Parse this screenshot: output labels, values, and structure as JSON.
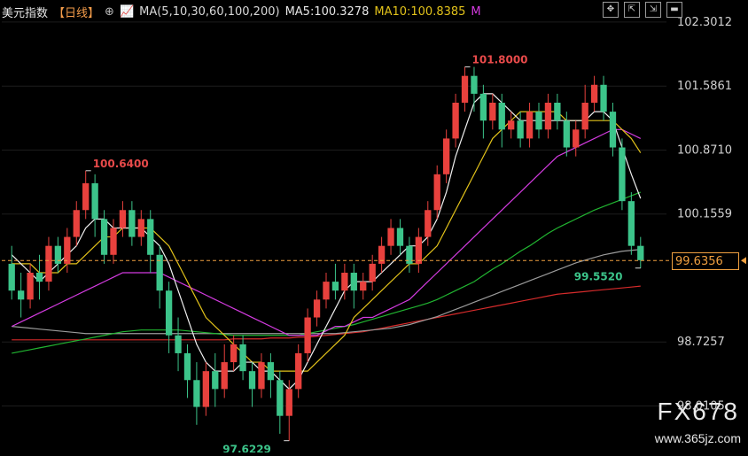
{
  "header": {
    "title": "美元指数",
    "period": "【日线】",
    "ma_label": "MA(5,10,30,60,100,200)",
    "ma5": "MA5:100.3278",
    "ma10": "MA10:100.8385",
    "ma_more": "M"
  },
  "watermark": {
    "brand": "FX678",
    "site": "www.365jz.com"
  },
  "current_price": "99.6356",
  "colors": {
    "up": "#e8413d",
    "down": "#3cc48a",
    "ma5": "#f0f0f0",
    "ma10": "#e2c21a",
    "ma30": "#d43be0",
    "ma60": "#21b531",
    "ma100": "#9b9b9b",
    "ma200": "#d62b2b",
    "price_line": "#f0a040"
  },
  "chart_data": {
    "type": "candlestick",
    "title": "美元指数",
    "ylim": [
      97.6,
      102.35
    ],
    "y_ticks": [
      "102.3012",
      "101.5861",
      "100.8710",
      "100.1559",
      "99.6356",
      "98.7257",
      "98.0105"
    ],
    "annotations": [
      {
        "text": "100.6400",
        "value": 100.64,
        "type": "high"
      },
      {
        "text": "101.8000",
        "value": 101.8,
        "type": "high"
      },
      {
        "text": "97.6229",
        "value": 97.6229,
        "type": "low"
      },
      {
        "text": "99.5520",
        "value": 99.552,
        "type": "low"
      }
    ],
    "current_price": 99.6356,
    "candles": [
      [
        99.6,
        99.3,
        99.8,
        99.2
      ],
      [
        99.3,
        99.2,
        99.5,
        99.0
      ],
      [
        99.2,
        99.5,
        99.6,
        99.1
      ],
      [
        99.5,
        99.4,
        99.7,
        99.2
      ],
      [
        99.4,
        99.8,
        99.9,
        99.3
      ],
      [
        99.8,
        99.6,
        99.9,
        99.5
      ],
      [
        99.6,
        99.9,
        100.0,
        99.5
      ],
      [
        99.9,
        100.2,
        100.3,
        99.8
      ],
      [
        100.2,
        100.5,
        100.64,
        100.1
      ],
      [
        100.5,
        100.1,
        100.6,
        99.9
      ],
      [
        100.1,
        99.7,
        100.2,
        99.6
      ],
      [
        99.7,
        100.0,
        100.1,
        99.6
      ],
      [
        100.0,
        100.2,
        100.3,
        99.9
      ],
      [
        100.2,
        99.9,
        100.3,
        99.8
      ],
      [
        99.9,
        100.1,
        100.2,
        99.8
      ],
      [
        100.1,
        99.7,
        100.2,
        99.5
      ],
      [
        99.7,
        99.3,
        99.8,
        99.1
      ],
      [
        99.3,
        98.8,
        99.4,
        98.6
      ],
      [
        98.8,
        98.6,
        99.0,
        98.4
      ],
      [
        98.6,
        98.3,
        98.7,
        98.1
      ],
      [
        98.3,
        98.0,
        98.5,
        97.8
      ],
      [
        98.0,
        98.4,
        98.5,
        97.9
      ],
      [
        98.4,
        98.2,
        98.6,
        98.0
      ],
      [
        98.2,
        98.5,
        98.7,
        98.1
      ],
      [
        98.5,
        98.7,
        98.8,
        98.4
      ],
      [
        98.7,
        98.4,
        98.8,
        98.3
      ],
      [
        98.4,
        98.2,
        98.5,
        98.0
      ],
      [
        98.2,
        98.5,
        98.6,
        98.1
      ],
      [
        98.5,
        98.3,
        98.6,
        98.1
      ],
      [
        98.3,
        97.9,
        98.4,
        97.7
      ],
      [
        97.9,
        98.2,
        98.3,
        97.62
      ],
      [
        98.2,
        98.6,
        98.7,
        98.1
      ],
      [
        98.6,
        99.0,
        99.1,
        98.5
      ],
      [
        99.0,
        99.2,
        99.3,
        98.9
      ],
      [
        99.2,
        99.4,
        99.5,
        99.1
      ],
      [
        99.4,
        99.3,
        99.6,
        99.2
      ],
      [
        99.3,
        99.5,
        99.6,
        99.2
      ],
      [
        99.5,
        99.3,
        99.6,
        99.1
      ],
      [
        99.3,
        99.4,
        99.5,
        99.2
      ],
      [
        99.4,
        99.6,
        99.7,
        99.3
      ],
      [
        99.6,
        99.8,
        99.9,
        99.5
      ],
      [
        99.8,
        100.0,
        100.1,
        99.7
      ],
      [
        100.0,
        99.8,
        100.1,
        99.7
      ],
      [
        99.8,
        99.6,
        99.9,
        99.5
      ],
      [
        99.6,
        99.9,
        100.0,
        99.5
      ],
      [
        99.9,
        100.2,
        100.3,
        99.8
      ],
      [
        100.2,
        100.6,
        100.7,
        100.1
      ],
      [
        100.6,
        101.0,
        101.1,
        100.5
      ],
      [
        101.0,
        101.4,
        101.5,
        100.9
      ],
      [
        101.4,
        101.7,
        101.8,
        101.3
      ],
      [
        101.7,
        101.5,
        101.8,
        101.3
      ],
      [
        101.5,
        101.2,
        101.6,
        101.0
      ],
      [
        101.2,
        101.4,
        101.5,
        101.1
      ],
      [
        101.4,
        101.1,
        101.5,
        100.9
      ],
      [
        101.1,
        101.2,
        101.3,
        101.0
      ],
      [
        101.2,
        101.0,
        101.3,
        100.9
      ],
      [
        101.0,
        101.3,
        101.4,
        100.9
      ],
      [
        101.3,
        101.1,
        101.4,
        101.0
      ],
      [
        101.1,
        101.4,
        101.5,
        101.0
      ],
      [
        101.4,
        101.2,
        101.5,
        101.1
      ],
      [
        101.2,
        100.9,
        101.3,
        100.8
      ],
      [
        100.9,
        101.1,
        101.2,
        100.8
      ],
      [
        101.1,
        101.4,
        101.6,
        101.0
      ],
      [
        101.4,
        101.6,
        101.7,
        101.3
      ],
      [
        101.6,
        101.3,
        101.7,
        101.2
      ],
      [
        101.3,
        100.9,
        101.4,
        100.8
      ],
      [
        100.9,
        100.3,
        101.0,
        100.2
      ],
      [
        100.3,
        99.8,
        100.4,
        99.7
      ],
      [
        99.8,
        99.64,
        99.9,
        99.55
      ]
    ],
    "ma5": [
      99.7,
      99.6,
      99.5,
      99.4,
      99.5,
      99.6,
      99.7,
      99.8,
      100.0,
      100.1,
      100.1,
      100.0,
      100.0,
      100.0,
      100.0,
      99.9,
      99.8,
      99.6,
      99.3,
      99.0,
      98.7,
      98.5,
      98.4,
      98.4,
      98.4,
      98.5,
      98.5,
      98.4,
      98.4,
      98.3,
      98.2,
      98.3,
      98.5,
      98.7,
      98.9,
      99.1,
      99.3,
      99.4,
      99.4,
      99.4,
      99.5,
      99.6,
      99.7,
      99.8,
      99.8,
      99.9,
      100.1,
      100.4,
      100.8,
      101.1,
      101.4,
      101.5,
      101.5,
      101.4,
      101.3,
      101.2,
      101.2,
      101.2,
      101.2,
      101.2,
      101.2,
      101.2,
      101.2,
      101.3,
      101.3,
      101.2,
      100.9,
      100.6,
      100.33
    ],
    "ma10": [
      99.6,
      99.6,
      99.6,
      99.5,
      99.5,
      99.5,
      99.6,
      99.6,
      99.7,
      99.8,
      99.9,
      99.9,
      100.0,
      100.0,
      100.0,
      100.0,
      99.9,
      99.8,
      99.6,
      99.4,
      99.2,
      99.0,
      98.9,
      98.8,
      98.7,
      98.6,
      98.5,
      98.5,
      98.4,
      98.4,
      98.4,
      98.4,
      98.4,
      98.5,
      98.6,
      98.7,
      98.8,
      99.0,
      99.1,
      99.2,
      99.3,
      99.4,
      99.5,
      99.6,
      99.6,
      99.7,
      99.8,
      100.0,
      100.2,
      100.4,
      100.6,
      100.8,
      101.0,
      101.1,
      101.2,
      101.3,
      101.3,
      101.3,
      101.3,
      101.3,
      101.2,
      101.2,
      101.2,
      101.2,
      101.2,
      101.2,
      101.1,
      101.0,
      100.84
    ],
    "ma30": [
      98.9,
      98.95,
      99.0,
      99.05,
      99.1,
      99.15,
      99.2,
      99.25,
      99.3,
      99.35,
      99.4,
      99.45,
      99.5,
      99.5,
      99.5,
      99.5,
      99.5,
      99.45,
      99.4,
      99.35,
      99.3,
      99.25,
      99.2,
      99.15,
      99.1,
      99.05,
      99.0,
      98.95,
      98.9,
      98.85,
      98.8,
      98.8,
      98.8,
      98.8,
      98.85,
      98.9,
      98.9,
      98.95,
      99.0,
      99.0,
      99.05,
      99.1,
      99.15,
      99.2,
      99.3,
      99.4,
      99.5,
      99.6,
      99.7,
      99.8,
      99.9,
      100.0,
      100.1,
      100.2,
      100.3,
      100.4,
      100.5,
      100.6,
      100.7,
      100.8,
      100.85,
      100.9,
      100.95,
      101.0,
      101.05,
      101.1,
      101.1,
      101.05,
      101.0
    ],
    "ma60": [
      98.6,
      98.62,
      98.64,
      98.66,
      98.68,
      98.7,
      98.72,
      98.74,
      98.76,
      98.78,
      98.8,
      98.82,
      98.84,
      98.85,
      98.86,
      98.86,
      98.86,
      98.86,
      98.86,
      98.85,
      98.84,
      98.83,
      98.82,
      98.81,
      98.8,
      98.8,
      98.8,
      98.8,
      98.8,
      98.8,
      98.8,
      98.8,
      98.82,
      98.84,
      98.86,
      98.88,
      98.9,
      98.92,
      98.95,
      98.98,
      99.01,
      99.04,
      99.07,
      99.1,
      99.13,
      99.16,
      99.2,
      99.25,
      99.3,
      99.35,
      99.4,
      99.47,
      99.54,
      99.6,
      99.67,
      99.74,
      99.8,
      99.87,
      99.94,
      100.0,
      100.05,
      100.1,
      100.15,
      100.2,
      100.24,
      100.28,
      100.32,
      100.36,
      100.4
    ],
    "ma100": [
      98.9,
      98.89,
      98.88,
      98.87,
      98.86,
      98.85,
      98.84,
      98.83,
      98.82,
      98.82,
      98.82,
      98.82,
      98.82,
      98.82,
      98.82,
      98.82,
      98.82,
      98.82,
      98.82,
      98.82,
      98.82,
      98.82,
      98.82,
      98.82,
      98.82,
      98.82,
      98.82,
      98.82,
      98.82,
      98.82,
      98.82,
      98.82,
      98.82,
      98.82,
      98.82,
      98.82,
      98.83,
      98.84,
      98.85,
      98.86,
      98.87,
      98.88,
      98.9,
      98.92,
      98.95,
      98.98,
      99.01,
      99.05,
      99.09,
      99.13,
      99.17,
      99.21,
      99.25,
      99.29,
      99.33,
      99.37,
      99.41,
      99.45,
      99.49,
      99.53,
      99.57,
      99.61,
      99.64,
      99.67,
      99.7,
      99.72,
      99.74,
      99.75,
      99.76
    ],
    "ma200": [
      98.75,
      98.75,
      98.75,
      98.75,
      98.75,
      98.75,
      98.75,
      98.75,
      98.75,
      98.75,
      98.75,
      98.75,
      98.75,
      98.75,
      98.75,
      98.75,
      98.75,
      98.75,
      98.75,
      98.75,
      98.75,
      98.75,
      98.75,
      98.75,
      98.76,
      98.76,
      98.76,
      98.76,
      98.77,
      98.77,
      98.77,
      98.78,
      98.78,
      98.79,
      98.8,
      98.81,
      98.82,
      98.83,
      98.84,
      98.86,
      98.88,
      98.9,
      98.92,
      98.94,
      98.96,
      98.98,
      99.0,
      99.02,
      99.04,
      99.06,
      99.08,
      99.1,
      99.12,
      99.14,
      99.16,
      99.18,
      99.2,
      99.22,
      99.24,
      99.26,
      99.27,
      99.28,
      99.29,
      99.3,
      99.31,
      99.32,
      99.33,
      99.34,
      99.35
    ]
  }
}
